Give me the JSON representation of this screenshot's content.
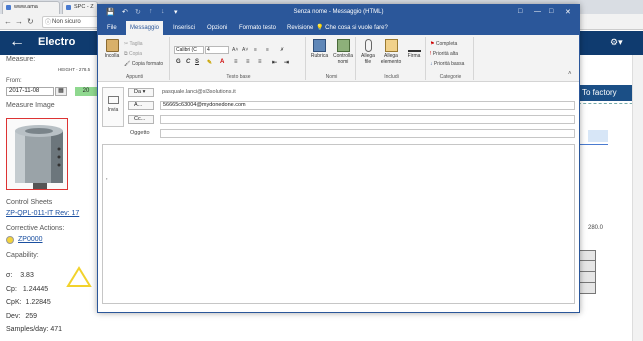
{
  "browser": {
    "tabs": [
      "www.ama",
      "SPC - Z"
    ],
    "address": "Non sicuro"
  },
  "webapp": {
    "logo": "Electro",
    "measure_label": "Measure:",
    "height_text": "HEIGHT - 278.5",
    "from_label": "From:",
    "date_value": "2017-11-08",
    "green_value": "20",
    "measure_image_label": "Measure Image",
    "control_sheets_label": "Control Sheets",
    "control_sheet_link": "ZP-QPL-011-IT Rev: 17",
    "corrective_actions_label": "Corrective Actions:",
    "corrective_link": "ZP0000",
    "capability_label": "Capability:",
    "stats": [
      {
        "label": "σ:",
        "value": "3.83"
      },
      {
        "label": "Cp:",
        "value": "1.24445"
      },
      {
        "label": "CpK:",
        "value": "1.22845"
      },
      {
        "label": "Dev:",
        "value": "259"
      },
      {
        "label": "Samples/day:",
        "value": "471"
      }
    ],
    "to_factory_label": "To factory",
    "axis_value": "280.0"
  },
  "outlook": {
    "window_title": "Senza nome - Messaggio (HTML)",
    "ribbon_tabs": [
      "File",
      "Messaggio",
      "Inserisci",
      "Opzioni",
      "Formato testo",
      "Revisione"
    ],
    "active_tab": "Messaggio",
    "tell_me": "Che cosa si vuole fare?",
    "groups": {
      "clipboard": {
        "name": "Appunti",
        "paste": "Incolla",
        "cut": "Taglia",
        "copy": "Copia",
        "format_painter": "Copia formato"
      },
      "basic_text": {
        "name": "Testo base",
        "font": "Calibri (C",
        "size": "4"
      },
      "names": {
        "name": "Nomi",
        "address_book": "Rubrica",
        "check_names": "Controlla nomi"
      },
      "include": {
        "name": "Includi",
        "attach_file": "Allega file",
        "attach_item": "Allega elemento",
        "signature": "Firma"
      },
      "tags": {
        "name": "Categorie",
        "follow_up": "Completa",
        "high": "Priorità alta",
        "low": "Priorità bassa"
      }
    },
    "send_label": "Invia",
    "from_button": "Da",
    "from_value": "pasquale.lanci@sl3solutions.it",
    "to_button": "A...",
    "to_value": "56665c63004@mydonedone.com",
    "cc_button": "Cc...",
    "cc_value": "",
    "subject_label": "Oggetto",
    "subject_value": ""
  }
}
